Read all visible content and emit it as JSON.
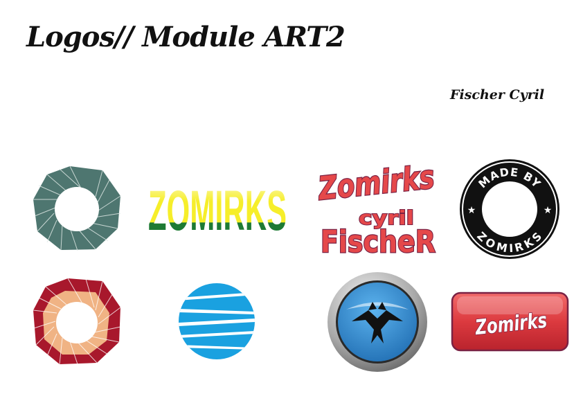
{
  "page": {
    "title": "Logos// Module ART2",
    "author": "Fischer Cyril"
  },
  "logos": {
    "wordmark_green": "ZOMIRKS",
    "script_word": "Zomirks",
    "stack_top": "cyril",
    "stack_bottom": "FischeR",
    "badge_top": "MADE BY",
    "badge_bottom": "ZOMIRKS",
    "button_word": "Zomirks"
  },
  "colors": {
    "teal": "#4e7670",
    "crimson": "#a8182c",
    "peach": "#f0b384",
    "yellow": "#f6ee2a",
    "green": "#1e7a34",
    "coral": "#e5484a",
    "plum": "#7a2244",
    "blue": "#1aa1e0",
    "deep_blue": "#2b7fc4",
    "black": "#111111",
    "silver": "#b8b8b8"
  }
}
